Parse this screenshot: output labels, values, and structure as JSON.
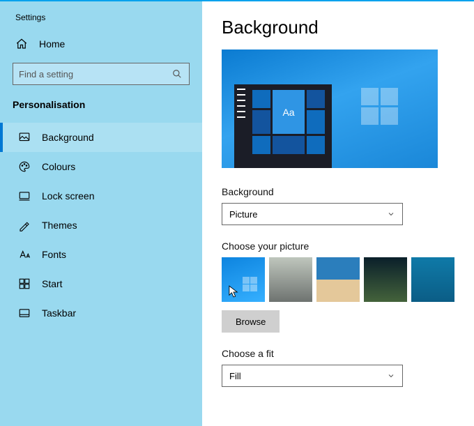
{
  "app_title": "Settings",
  "home_label": "Home",
  "search": {
    "placeholder": "Find a setting"
  },
  "section_label": "Personalisation",
  "nav": {
    "items": [
      {
        "icon": "background-icon",
        "label": "Background",
        "active": true
      },
      {
        "icon": "colours-icon",
        "label": "Colours",
        "active": false
      },
      {
        "icon": "lockscreen-icon",
        "label": "Lock screen",
        "active": false
      },
      {
        "icon": "themes-icon",
        "label": "Themes",
        "active": false
      },
      {
        "icon": "fonts-icon",
        "label": "Fonts",
        "active": false
      },
      {
        "icon": "start-icon",
        "label": "Start",
        "active": false
      },
      {
        "icon": "taskbar-icon",
        "label": "Taskbar",
        "active": false
      }
    ]
  },
  "main": {
    "title": "Background",
    "preview_tile_label": "Aa",
    "background_dropdown": {
      "label": "Background",
      "value": "Picture"
    },
    "choose_picture_label": "Choose your picture",
    "thumbnails": [
      {
        "name": "windows-default",
        "selected": true
      },
      {
        "name": "rocks",
        "selected": false
      },
      {
        "name": "beach",
        "selected": false
      },
      {
        "name": "aurora",
        "selected": false
      },
      {
        "name": "underwater",
        "selected": false
      }
    ],
    "browse_label": "Browse",
    "fit_dropdown": {
      "label": "Choose a fit",
      "value": "Fill"
    }
  },
  "colors": {
    "accent": "#0078d4",
    "sidebar_bg": "#99d9ef"
  }
}
